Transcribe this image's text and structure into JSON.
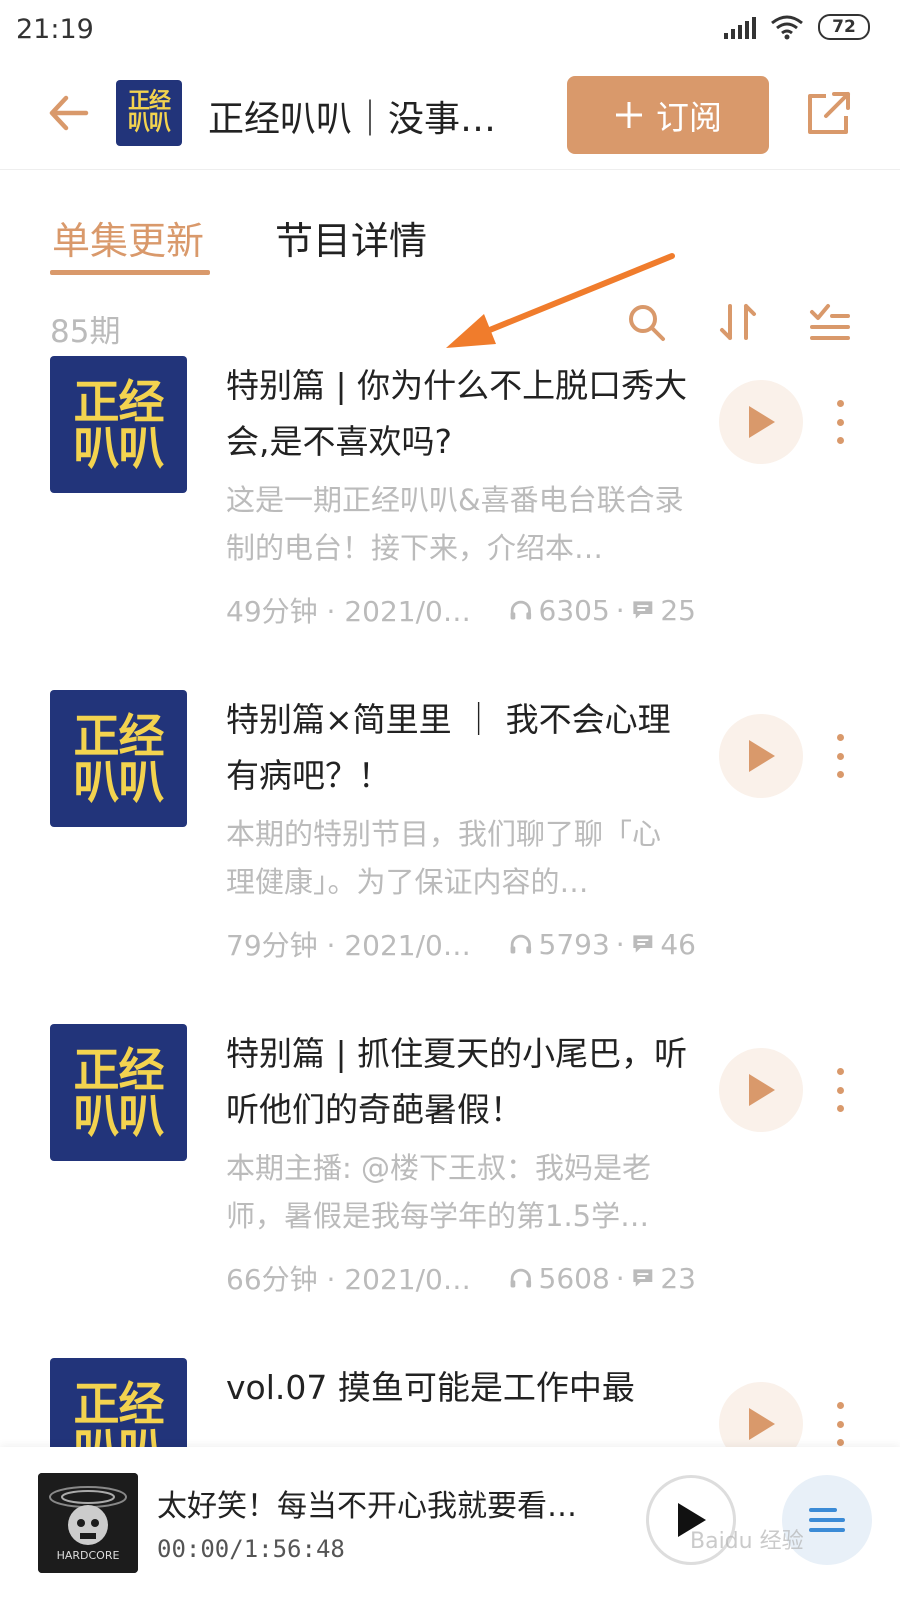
{
  "status_bar": {
    "time": "21:19",
    "battery": "72"
  },
  "header": {
    "logo_line1": "正经",
    "logo_line2": "叭叭",
    "title": "正经叭叭｜没事…",
    "subscribe_label": "订阅",
    "subscribe_icon": "plus-icon"
  },
  "tabs": [
    {
      "label": "单集更新",
      "active": true
    },
    {
      "label": "节目详情",
      "active": false
    }
  ],
  "toolbar": {
    "count": "85期"
  },
  "episodes": [
    {
      "cover_line1": "正经",
      "cover_line2": "叭叭",
      "title": "特别篇 | 你为什么不上脱口秀大会,是不喜欢吗?",
      "desc": "这是一期正经叭叭&喜番电台联合录制的电台！接下来，介绍本…",
      "duration_date": "49分钟 · 2021/0…",
      "plays": "6305",
      "comments": "25"
    },
    {
      "cover_line1": "正经",
      "cover_line2": "叭叭",
      "title": "特别篇×简里里 ｜ 我不会心理有病吧？！",
      "desc": "本期的特别节目，我们聊了聊「心理健康」。为了保证内容的…",
      "duration_date": "79分钟 · 2021/0…",
      "plays": "5793",
      "comments": "46"
    },
    {
      "cover_line1": "正经",
      "cover_line2": "叭叭",
      "title": "特别篇 | 抓住夏天的小尾巴，听听他们的奇葩暑假！",
      "desc": "本期主播: @楼下王叔：我妈是老师，暑假是我每学年的第1.5学…",
      "duration_date": "66分钟 · 2021/0…",
      "plays": "5608",
      "comments": "23"
    },
    {
      "cover_line1": "正经",
      "cover_line2": "叭叭",
      "title": "vol.07 摸鱼可能是工作中最"
    }
  ],
  "player": {
    "title": "太好笑！每当不开心我就要看…",
    "time": "00:00/1:56:48",
    "cover_text": "HARDCORE"
  },
  "colors": {
    "accent": "#d9996b",
    "cover_bg": "#22347a",
    "cover_text": "#f3d34f",
    "muted": "#bbbbbb",
    "arrow": "#f07c2c"
  },
  "watermark": "Baidu 经验"
}
